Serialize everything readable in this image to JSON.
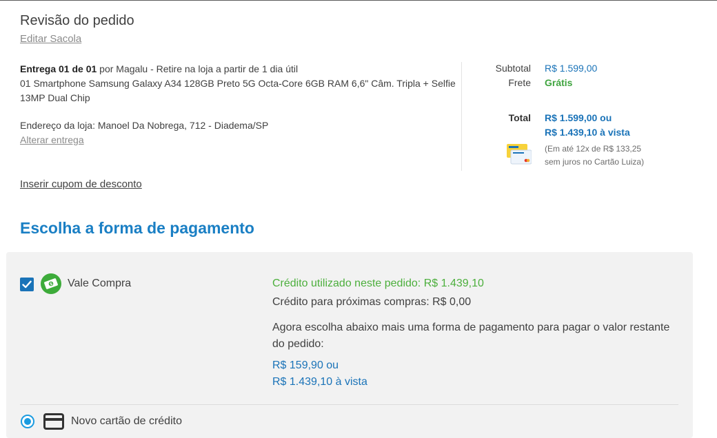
{
  "review": {
    "title": "Revisão do pedido",
    "edit_bag": "Editar Sacola"
  },
  "delivery": {
    "label_bold": "Entrega 01 de 01",
    "label_rest": " por Magalu - Retire na loja a partir de 1 dia útil",
    "product": "01 Smartphone Samsung Galaxy A34 128GB Preto 5G Octa-Core 6GB RAM 6,6\" Câm. Tripla + Selfie 13MP Dual Chip",
    "address": "Endereço da loja: Manoel Da Nobrega, 712 - Diadema/SP",
    "alter_link": "Alterar entrega"
  },
  "summary": {
    "subtotal_label": "Subtotal",
    "subtotal_value": "R$ 1.599,00",
    "shipping_label": "Frete",
    "shipping_value": "Grátis",
    "total_label": "Total",
    "total_line1": "R$ 1.599,00 ou",
    "total_line2": "R$ 1.439,10 à vista",
    "installments_line1": "(Em até 12x de R$ 133,25",
    "installments_line2": "sem juros no Cartão Luiza)"
  },
  "coupon_link": "Inserir cupom de desconto",
  "payment": {
    "title": "Escolha a forma de pagamento",
    "vale_compra": {
      "label": "Vale Compra",
      "checked": true,
      "credit_used": "Crédito utilizado neste pedido: R$ 1.439,10",
      "credit_next": "Crédito para próximas compras: R$ 0,00",
      "instruction": "Agora escolha abaixo mais uma forma de pagamento para pagar o valor restante do pedido:",
      "price_line1": "R$ 159,90 ou",
      "price_line2": "R$ 1.439,10 à vista"
    },
    "new_card": {
      "label": "Novo cartão de crédito",
      "selected": true
    }
  },
  "icons": {
    "vale": "vale-compra-icon",
    "card": "credit-card-icon",
    "luiza_card": "cartao-luiza-icon",
    "check": "check-icon"
  },
  "colors": {
    "accent_blue": "#1a73b8",
    "title_blue": "#1a7fc4",
    "green": "#3fa43f",
    "radio_blue": "#1a9be0",
    "panel_bg": "#f2f2f2"
  }
}
